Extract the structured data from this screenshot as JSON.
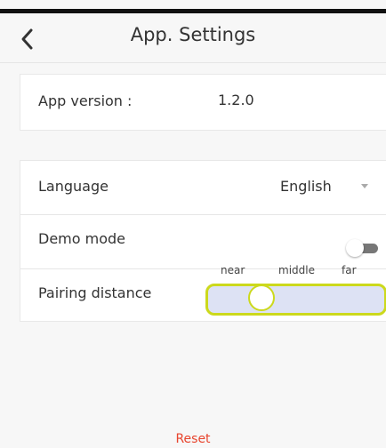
{
  "header": {
    "title": "App. Settings",
    "back_icon": "chevron-left-icon"
  },
  "app_info": {
    "version_label": "App version :",
    "version_value": "1.2.0"
  },
  "settings": {
    "language_label": "Language",
    "language_value": "English",
    "demo_mode_label": "Demo mode",
    "demo_mode_enabled": false,
    "pairing_label": "Pairing distance",
    "pairing_ticks": [
      "near",
      "middle",
      "far"
    ],
    "pairing_value": "near"
  },
  "colors": {
    "accent_border": "#ccd91c",
    "slider_fill": "#dde2f4",
    "reset_text": "#e8452e"
  },
  "footer": {
    "reset_label": "Reset"
  }
}
